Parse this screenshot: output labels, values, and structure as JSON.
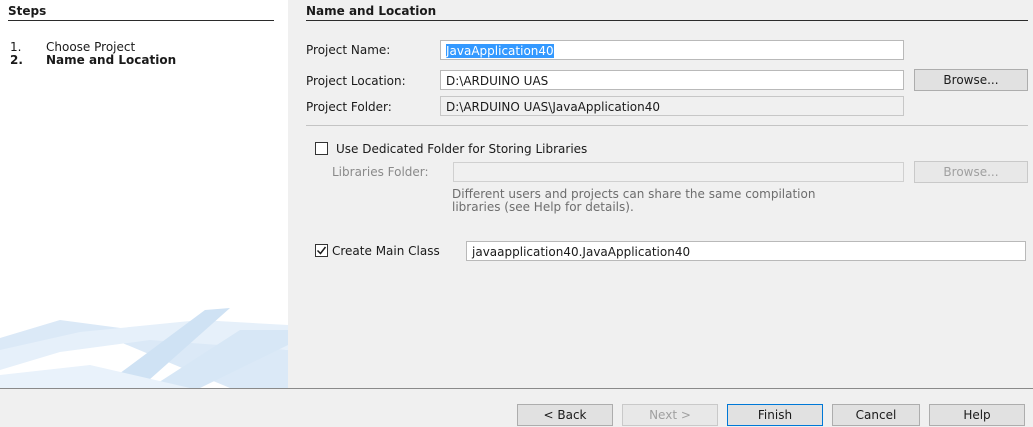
{
  "steps": {
    "title": "Steps",
    "items": [
      {
        "num": "1.",
        "label": "Choose Project"
      },
      {
        "num": "2.",
        "label": "Name and Location"
      }
    ]
  },
  "form": {
    "title": "Name and Location",
    "project_name_label": "Project Name:",
    "project_name_value": "JavaApplication40",
    "project_location_label": "Project Location:",
    "project_location_value": "D:\\ARDUINO UAS",
    "browse_label": "Browse...",
    "project_folder_label": "Project Folder:",
    "project_folder_value": "D:\\ARDUINO UAS\\JavaApplication40",
    "dedicated_folder_label": "Use Dedicated Folder for Storing Libraries",
    "dedicated_folder_checked": false,
    "libraries_folder_label": "Libraries Folder:",
    "libraries_folder_value": "",
    "libraries_browse_label": "Browse...",
    "libraries_help_line1": "Different users and projects can share the same compilation",
    "libraries_help_line2": "libraries (see Help for details).",
    "create_main_class_label": "Create Main Class",
    "create_main_class_checked": true,
    "main_class_value": "javaapplication40.JavaApplication40"
  },
  "buttons": {
    "back": "< Back",
    "next": "Next >",
    "finish": "Finish",
    "cancel": "Cancel",
    "help": "Help"
  },
  "colors": {
    "selection": "#3399ff",
    "focus_border": "#0078d7"
  }
}
